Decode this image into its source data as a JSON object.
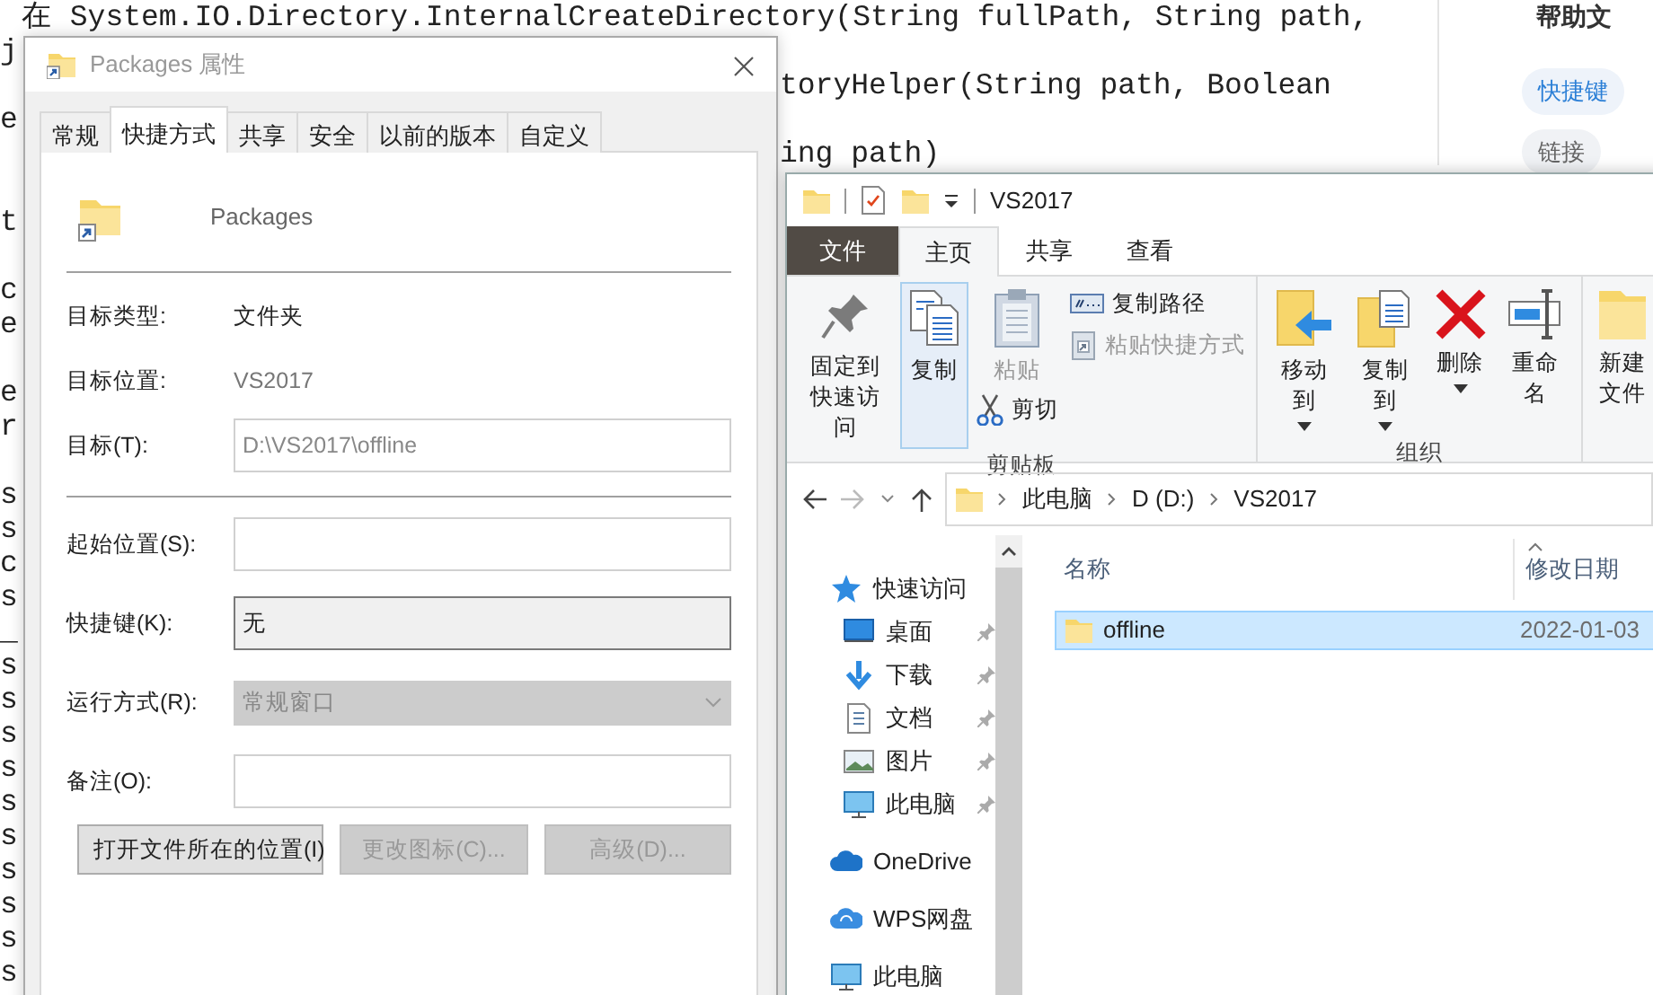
{
  "code_editor": {
    "blocks": [
      [
        {
          "full": "在 System.IO.Directory.InternalCreateDirectory(String fullPath, String path,"
        },
        {
          "left": "j"
        },
        {
          "right": "toryHelper(String path, Boolean"
        },
        {
          "left": "e"
        },
        {
          "right": "ing path)"
        }
      ],
      [
        {
          "left": "t"
        }
      ],
      [
        {
          "left": "c"
        },
        {
          "left": "e"
        }
      ],
      [
        {
          "left": "e"
        },
        {
          "left": "r"
        }
      ],
      [
        {
          "left": "s"
        },
        {
          "left": "s"
        },
        {
          "left": "c"
        },
        {
          "left": "s"
        },
        {
          "left": "_"
        },
        {
          "left": "s"
        },
        {
          "left": "s"
        },
        {
          "left": "s"
        },
        {
          "left": "s"
        },
        {
          "left": "s"
        },
        {
          "left": "s"
        },
        {
          "left": "s"
        },
        {
          "left": "s"
        },
        {
          "left": "s"
        },
        {
          "left": "s"
        }
      ]
    ]
  },
  "help_panel": {
    "title": "帮助文",
    "tags": [
      {
        "label": "快捷键",
        "selected": true
      },
      {
        "label": "链接",
        "selected": false
      }
    ]
  },
  "properties_dialog": {
    "title": "Packages 属性",
    "tabs": [
      {
        "label": "常规",
        "selected": false
      },
      {
        "label": "快捷方式",
        "selected": true
      },
      {
        "label": "共享",
        "selected": false
      },
      {
        "label": "安全",
        "selected": false
      },
      {
        "label": "以前的版本",
        "selected": false
      },
      {
        "label": "自定义",
        "selected": false
      }
    ],
    "shortcut_name": "Packages",
    "fields": [
      {
        "kind": "text",
        "label": "目标类型:",
        "value": "文件夹",
        "disabled": false
      },
      {
        "kind": "text",
        "label": "目标位置:",
        "value": "VS2017",
        "disabled": true
      },
      {
        "kind": "input",
        "label": "目标(T):",
        "value": "D:\\VS2017\\offline",
        "disabled": true
      },
      {
        "kind": "separator"
      },
      {
        "kind": "input",
        "label": "起始位置(S):"
      },
      {
        "kind": "hotkey",
        "label": "快捷键(K):",
        "value": "无"
      },
      {
        "kind": "select",
        "label": "运行方式(R):",
        "value": "常规窗口",
        "disabled": true
      },
      {
        "kind": "input",
        "label": "备注(O):"
      }
    ],
    "buttons": [
      {
        "label": "打开文件所在的位置(I)",
        "disabled": false
      },
      {
        "label": "更改图标(C)...",
        "disabled": true
      },
      {
        "label": "高级(D)...",
        "disabled": true
      }
    ]
  },
  "explorer": {
    "title": "VS2017",
    "ribbon_tabs": [
      {
        "label": "文件",
        "kind": "file",
        "selected": false
      },
      {
        "label": "主页",
        "kind": "tab",
        "selected": true
      },
      {
        "label": "共享",
        "kind": "tab",
        "selected": false
      },
      {
        "label": "查看",
        "kind": "tab",
        "selected": false
      }
    ],
    "ribbon_groups": [
      {
        "label": "剪贴板",
        "items": [
          {
            "kind": "large",
            "label": "固定到快速访问",
            "selected": false,
            "disabled": false,
            "dropdown": false
          },
          {
            "kind": "large",
            "label": "复制",
            "selected": true,
            "disabled": false,
            "dropdown": false
          },
          {
            "kind": "paste",
            "label": "粘贴",
            "selected": false,
            "disabled": true,
            "dropdown": false
          },
          {
            "kind": "small",
            "label": "复制路径",
            "selected": false,
            "disabled": false
          },
          {
            "kind": "small",
            "label": "粘贴快捷方式",
            "selected": false,
            "disabled": true
          },
          {
            "kind": "small",
            "label": "剪切",
            "selected": false,
            "disabled": false
          }
        ]
      },
      {
        "label": "组织",
        "items": [
          {
            "kind": "large",
            "label": "移动到",
            "selected": false,
            "disabled": false,
            "dropdown": true
          },
          {
            "kind": "large",
            "label": "复制到",
            "selected": false,
            "disabled": false,
            "dropdown": true
          },
          {
            "kind": "large",
            "label": "删除",
            "selected": false,
            "disabled": false,
            "dropdown": true
          },
          {
            "kind": "large",
            "label": "重命名",
            "selected": false,
            "disabled": false,
            "dropdown": false
          }
        ]
      },
      {
        "items": [
          {
            "kind": "large",
            "label": "新建文件",
            "selected": false,
            "disabled": false,
            "dropdown": false
          }
        ]
      }
    ],
    "breadcrumbs": [
      "此电脑",
      "D (D:)",
      "VS2017"
    ],
    "nav_items": [
      {
        "label": "快速访问",
        "children": [
          {
            "label": "桌面",
            "pinned": true
          },
          {
            "label": "下载",
            "pinned": true
          },
          {
            "label": "文档",
            "pinned": true
          },
          {
            "label": "图片",
            "pinned": true
          },
          {
            "label": "此电脑",
            "pinned": true
          }
        ]
      },
      {
        "label": "OneDrive"
      },
      {
        "label": "WPS网盘"
      },
      {
        "label": "此电脑"
      }
    ],
    "columns": [
      "名称",
      "修改日期"
    ],
    "rows": [
      {
        "name": "offline",
        "date": "2022-01-03",
        "selected": true
      }
    ]
  }
}
